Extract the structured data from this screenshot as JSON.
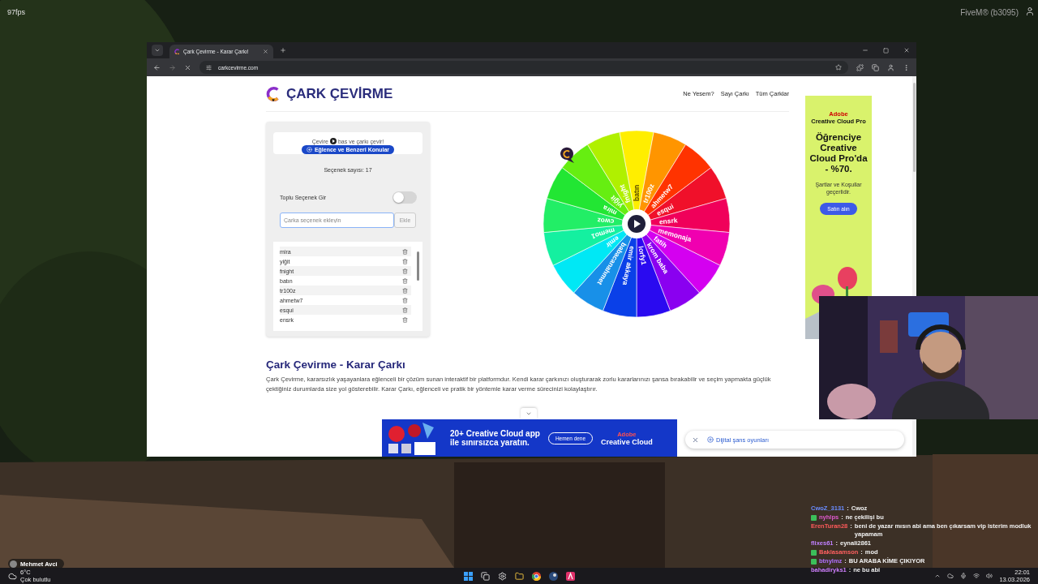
{
  "overlay": {
    "fps": "97fps",
    "game_build": "FiveM® (b3095)"
  },
  "browser": {
    "tab_title": "Çark Çevirme - Karar Çarkı!",
    "url": "carkcevirme.com"
  },
  "site": {
    "brand": "ÇARK ÇEVİRME",
    "nav": [
      "Ne Yesem?",
      "Sayı Çarkı",
      "Tüm Çarklar"
    ]
  },
  "panel": {
    "hint_before": "Çevire",
    "hint_after": "bas ve çarkı çevir!",
    "category": "Eğlence ve Benzeri Konular",
    "count": "Seçenek sayısı: 17",
    "bulk_toggle": {
      "label": "Toplu Seçenek Gir",
      "on": false
    },
    "input": {
      "placeholder": "Çarka seçenek ekleyin"
    },
    "add_button": "Ekle",
    "options": [
      "mira",
      "yiğit",
      "fnight",
      "batın",
      "tr100z",
      "ahmetw7",
      "esqui",
      "ensrk"
    ]
  },
  "wheel": {
    "segments": [
      {
        "label": "batın",
        "color": "#ffee00"
      },
      {
        "label": "tr100z",
        "color": "#ff9500"
      },
      {
        "label": "ahmetw7",
        "color": "#ff3300"
      },
      {
        "label": "esqui",
        "color": "#f0102a"
      },
      {
        "label": "ensrk",
        "color": "#f0005a"
      },
      {
        "label": "memonaja",
        "color": "#f000b0"
      },
      {
        "label": "fatih",
        "color": "#d400f0"
      },
      {
        "label": "krom baba",
        "color": "#8a00f0"
      },
      {
        "label": "lorfy1",
        "color": "#2a0af0"
      },
      {
        "label": "emir akkaya",
        "color": "#0a40e8"
      },
      {
        "label": "babacanahmet",
        "color": "#1890e8"
      },
      {
        "label": "emir",
        "color": "#00e8f5"
      },
      {
        "label": "memo1",
        "color": "#14f0a0"
      },
      {
        "label": "cwoz",
        "color": "#22ee66"
      },
      {
        "label": "mira",
        "color": "#22e633"
      },
      {
        "label": "yiğit",
        "color": "#66ee11"
      },
      {
        "label": "fnight",
        "color": "#b0f000"
      }
    ]
  },
  "article": {
    "title": "Çark Çevirme - Karar Çarkı",
    "text": "Çark Çevirme, kararsızlık yaşayanlara eğlenceli bir çözüm sunan interaktif bir platformdur. Kendi karar çarkınızı oluşturarak zorlu kararlarınızı şansa bırakabilir ve seçim yapmakta güçlük çektiğiniz durumlarda size yol gösterebilir. Karar Çarkı, eğlenceli ve pratik bir yöntemle karar verme sürecinizi kolaylaştırır."
  },
  "side_ad": {
    "brand": "Adobe",
    "product": "Creative Cloud Pro",
    "headline": "Öğrenciye Creative Cloud Pro'da - %70.",
    "terms": "Şartlar ve Koşullar geçerlidir.",
    "button": "Satın alın"
  },
  "bottom_ad": {
    "line1": "20+ Creative Cloud app",
    "line2": "ile sınırsızca yaratın.",
    "button": "Hemen dene",
    "brand": "Adobe",
    "product": "Creative Cloud"
  },
  "suggestion": {
    "label": "Dijital şans oyunları"
  },
  "streamer": {
    "name": "Mehmet Avci"
  },
  "chat": [
    {
      "user": "CwoZ_3131",
      "color": "#6a8cff",
      "separator": ":",
      "text": "Cwoz",
      "badge": false
    },
    {
      "user": "nyhlps",
      "color": "#e05ad0",
      "separator": ":",
      "text": "ne çekilişi bu",
      "badge": true
    },
    {
      "user": "ErenTuran28",
      "color": "#ff5a5a",
      "separator": ":",
      "text": "beni de yazar mısın abi ama ben çıkarsam vip isterim modluk yapamam",
      "badge": false
    },
    {
      "user": "flixes61",
      "color": "#c080ff",
      "separator": ":",
      "text": "eynali2861",
      "badge": false
    },
    {
      "user": "Baklasamson",
      "color": "#ff6060",
      "separator": ":",
      "text": "mod",
      "badge": true
    },
    {
      "user": "btnylmz",
      "color": "#b070ff",
      "separator": ":",
      "text": "BU ARABA KİME ÇIKIYOR",
      "badge": true
    },
    {
      "user": "bahadiryks1",
      "color": "#d080ff",
      "separator": ":",
      "text": "ne bu abi",
      "badge": false
    }
  ],
  "taskbar": {
    "temperature": "6°C",
    "weather": "Çok bulutlu",
    "time": "22:01",
    "date": "13.03.2026"
  }
}
